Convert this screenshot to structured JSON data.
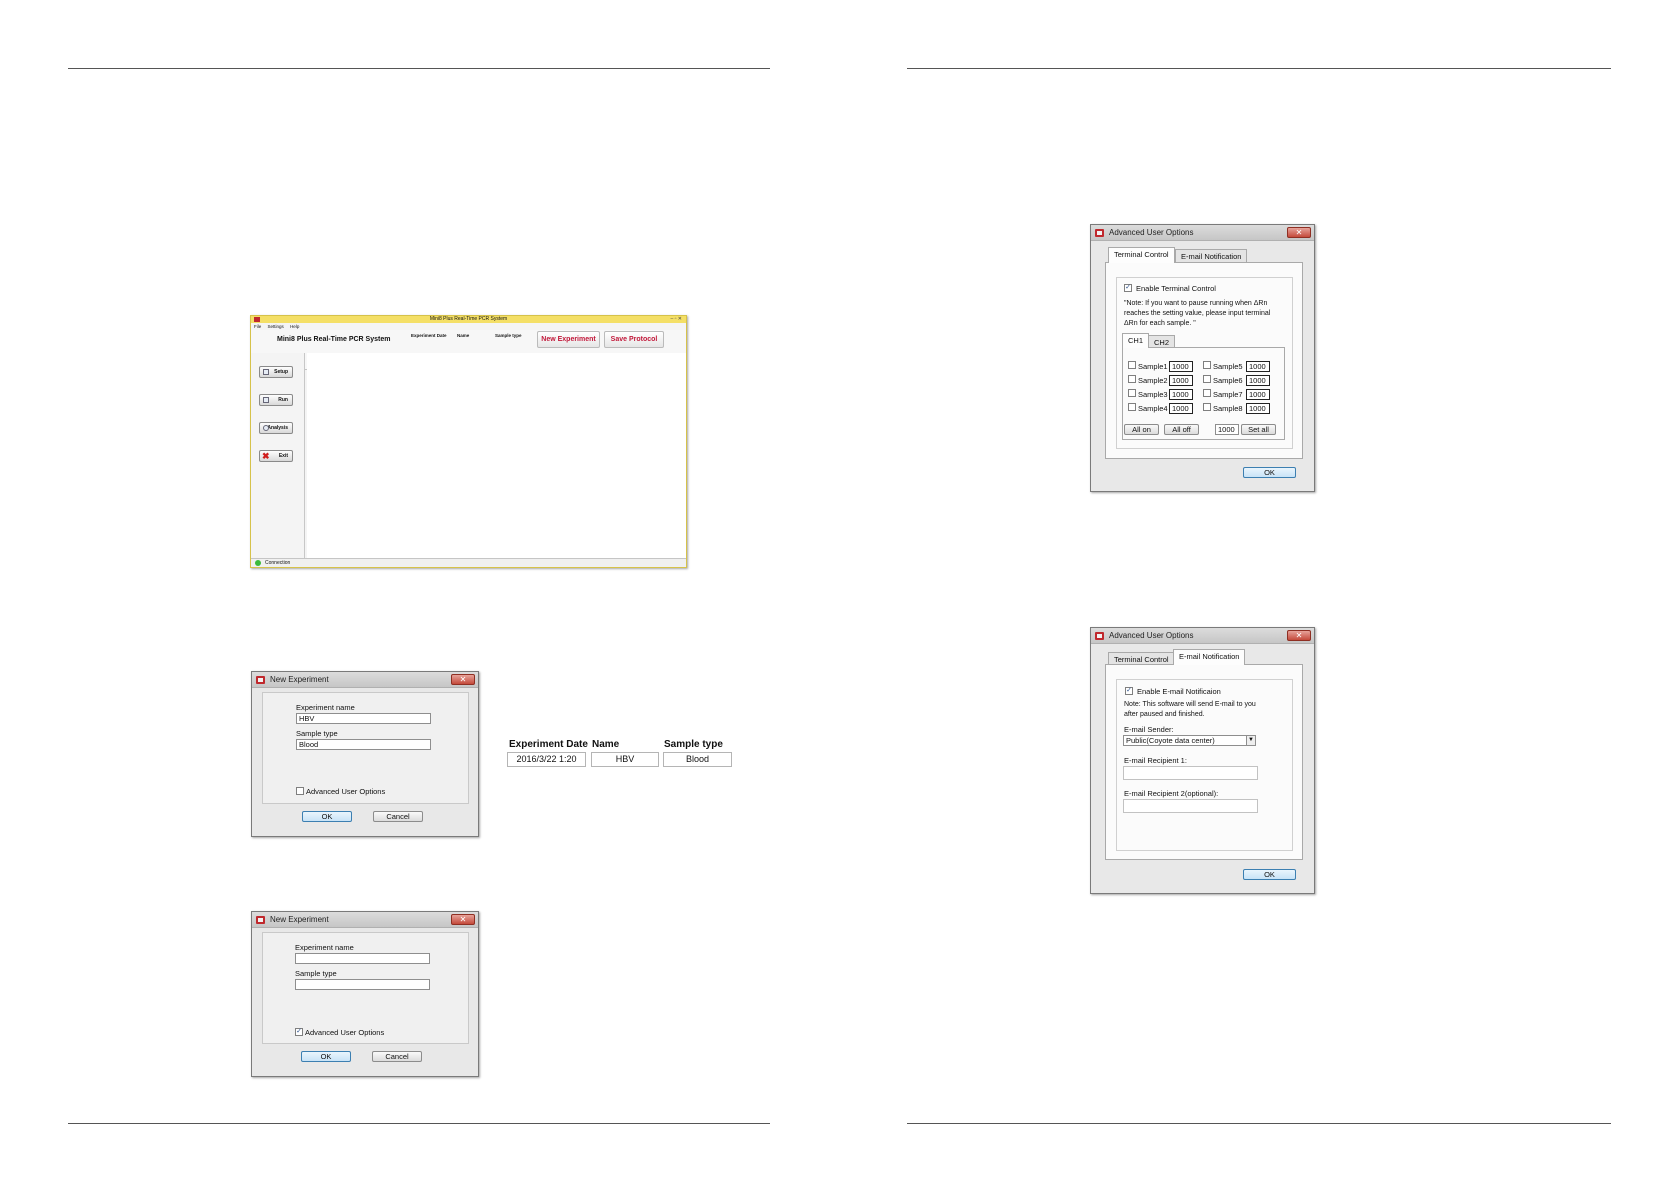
{
  "main_window": {
    "title": "Mini8 Plus Real-Time PCR System",
    "menu": [
      "File",
      "Settings",
      "Help"
    ],
    "app_heading": "Mini8 Plus Real-Time PCR System",
    "header_labels": [
      "Experiment Date",
      "Name",
      "Sample type"
    ],
    "new_experiment_label": "New Experiment",
    "save_protocol_label": "Save Protocol",
    "sidebar": [
      "Setup",
      "Run",
      "Analysis",
      "Exit"
    ],
    "status_text": "Connection",
    "status_color": "#3cba3c"
  },
  "new_experiment_filled": {
    "title": "New Experiment",
    "experiment_name_label": "Experiment name",
    "experiment_name_value": "HBV",
    "sample_type_label": "Sample type",
    "sample_type_value": "Blood",
    "advanced_label": "Advanced User Options",
    "advanced_checked": false,
    "ok_label": "OK",
    "cancel_label": "Cancel"
  },
  "info_table": {
    "headers": [
      "Experiment Date",
      "Name",
      "Sample type"
    ],
    "values": [
      "2016/3/22 1:20",
      "HBV",
      "Blood"
    ]
  },
  "new_experiment_empty": {
    "title": "New Experiment",
    "experiment_name_label": "Experiment name",
    "sample_type_label": "Sample type",
    "advanced_label": "Advanced User Options",
    "advanced_checked": true,
    "ok_label": "OK",
    "cancel_label": "Cancel"
  },
  "terminal_dialog": {
    "title": "Advanced User Options",
    "tabs": [
      "Terminal Control",
      "E-mail Notification"
    ],
    "enable_label": "Enable Terminal Control",
    "note_lines": [
      "\"Note: If you want to pause running when ΔRn",
      "reaches the setting value, please input terminal",
      "ΔRn for each sample. \""
    ],
    "channel_tabs": [
      "CH1",
      "CH2"
    ],
    "samples": [
      {
        "label": "Sample1",
        "value": "1000"
      },
      {
        "label": "Sample2",
        "value": "1000"
      },
      {
        "label": "Sample3",
        "value": "1000"
      },
      {
        "label": "Sample4",
        "value": "1000"
      },
      {
        "label": "Sample5",
        "value": "1000"
      },
      {
        "label": "Sample6",
        "value": "1000"
      },
      {
        "label": "Sample7",
        "value": "1000"
      },
      {
        "label": "Sample8",
        "value": "1000"
      }
    ],
    "all_on_label": "All on",
    "all_off_label": "All off",
    "set_all_value": "1000",
    "set_all_label": "Set all",
    "ok_label": "OK"
  },
  "email_dialog": {
    "title": "Advanced User Options",
    "tabs": [
      "Terminal Control",
      "E-mail Notification"
    ],
    "enable_label": "Enable E-mail Notificaion",
    "note_lines": [
      "Note: This software will send E-mail to you",
      "after paused and finished."
    ],
    "sender_label": "E-mail Sender:",
    "sender_value": "Public(Coyote data center)",
    "recipient1_label": "E-mail Recipient 1:",
    "recipient2_label": "E-mail Recipient 2(optional):",
    "ok_label": "OK"
  }
}
